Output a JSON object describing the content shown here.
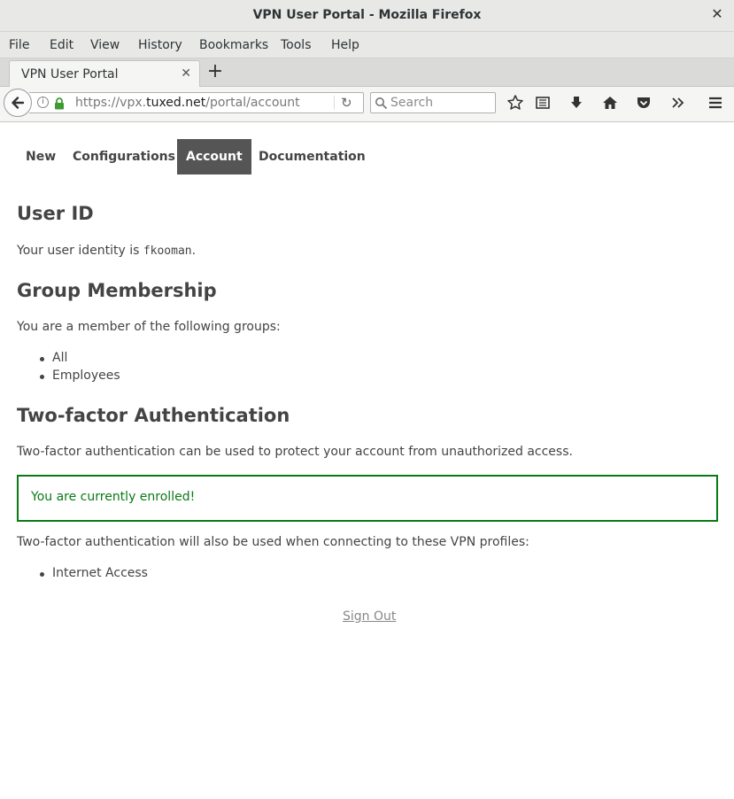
{
  "window": {
    "title": "VPN User Portal - Mozilla Firefox",
    "close_icon": "close-icon"
  },
  "menubar": {
    "items": [
      {
        "label": "File"
      },
      {
        "label": "Edit"
      },
      {
        "label": "View"
      },
      {
        "label": "History"
      },
      {
        "label": "Bookmarks"
      },
      {
        "label": "Tools"
      },
      {
        "label": "Help"
      }
    ]
  },
  "tabs": [
    {
      "title": "VPN User Portal",
      "active": true
    }
  ],
  "navbar": {
    "url_prefix": "https://vpx.",
    "url_domain": "tuxed.net",
    "url_path": "/portal/account",
    "search_placeholder": "Search"
  },
  "portal": {
    "nav": [
      "New",
      "Configurations",
      "Account",
      "Documentation"
    ],
    "active_nav": "Account",
    "user_id": {
      "heading": "User ID",
      "text_before": "Your user identity is ",
      "user": "fkooman",
      "text_after": "."
    },
    "groups": {
      "heading": "Group Membership",
      "intro": "You are a member of the following groups:",
      "items": [
        "All",
        "Employees"
      ]
    },
    "two_factor": {
      "heading": "Two-factor Authentication",
      "intro": "Two-factor authentication can be used to protect your account from unauthorized access.",
      "status": "You are currently enrolled!",
      "profiles_intro": "Two-factor authentication will also be used when connecting to these VPN profiles:",
      "profiles": [
        "Internet Access"
      ]
    },
    "sign_out": "Sign Out"
  },
  "colors": {
    "accent_active_tab": "#555555",
    "success": "#0a7a16",
    "text": "#444444"
  }
}
